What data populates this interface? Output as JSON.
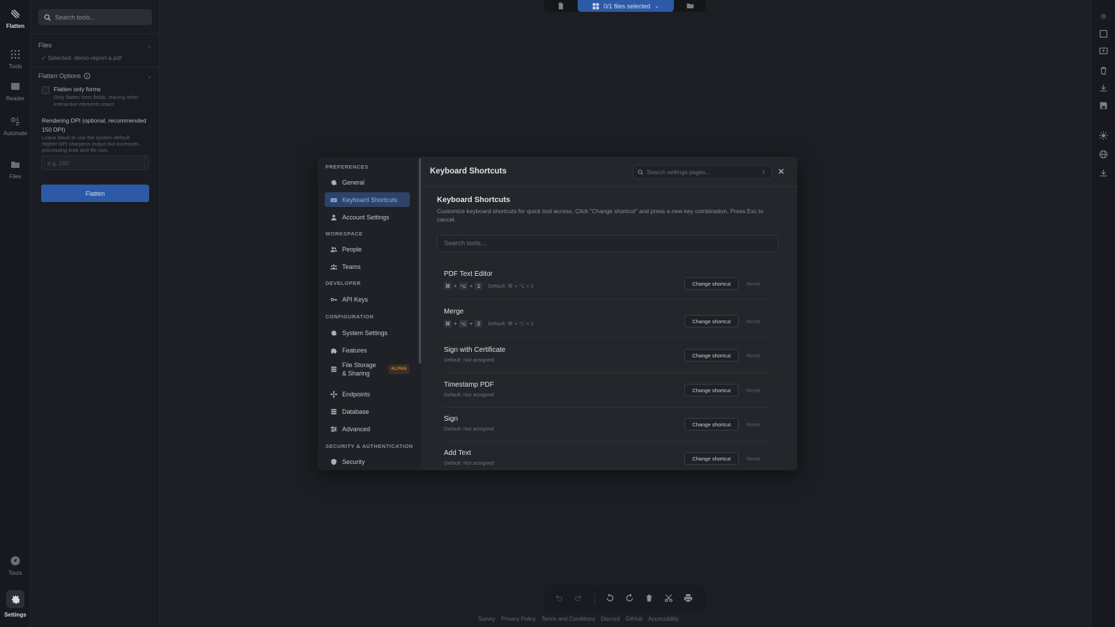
{
  "rail": {
    "items": [
      {
        "label": "Flatten",
        "icon": "flatten-icon"
      },
      {
        "label": "Tools",
        "icon": "grid-icon"
      },
      {
        "label": "Reader",
        "icon": "reader-icon"
      },
      {
        "label": "Automate",
        "icon": "automate-icon"
      },
      {
        "label": "Files",
        "icon": "folder-icon"
      },
      {
        "label": "Tours",
        "icon": "tours-icon"
      },
      {
        "label": "Settings",
        "icon": "gear-icon"
      }
    ]
  },
  "tool_panel": {
    "search_placeholder": "Search tools...",
    "files_header": "Files",
    "selected_file": "✓ Selected: demo-report-a.pdf",
    "options_header": "Flatten Options",
    "flatten_forms_label": "Flatten only forms",
    "flatten_forms_desc": "Only flatten form fields, leaving other interactive elements intact",
    "dpi_label": "Rendering DPI (optional, recommended 150 DPI)",
    "dpi_desc": "Leave blank to use the system default. Higher DPI sharpens output but increases processing time and file size.",
    "dpi_placeholder": "e.g. 150",
    "flatten_button": "Flatten"
  },
  "topbar": {
    "files_selected": "0/1 files selected"
  },
  "modal": {
    "title": "Keyboard Shortcuts",
    "search_placeholder": "Search settings pages...",
    "nav": {
      "groups": [
        "PREFERENCES",
        "WORKSPACE",
        "DEVELOPER",
        "CONFIGURATION",
        "SECURITY & AUTHENTICATION"
      ],
      "items": [
        {
          "label": "General",
          "icon": "gear-icon"
        },
        {
          "label": "Keyboard Shortcuts",
          "icon": "keyboard-icon"
        },
        {
          "label": "Account Settings",
          "icon": "user-icon"
        },
        {
          "label": "People",
          "icon": "people-icon"
        },
        {
          "label": "Teams",
          "icon": "teams-icon"
        },
        {
          "label": "API Keys",
          "icon": "key-icon"
        },
        {
          "label": "System Settings",
          "icon": "gear-icon"
        },
        {
          "label": "Features",
          "icon": "puzzle-icon"
        },
        {
          "label": "File Storage & Sharing",
          "icon": "storage-icon",
          "badge": "ALPHA"
        },
        {
          "label": "Endpoints",
          "icon": "endpoints-icon"
        },
        {
          "label": "Database",
          "icon": "database-icon"
        },
        {
          "label": "Advanced",
          "icon": "sliders-icon"
        },
        {
          "label": "Security",
          "icon": "shield-icon"
        }
      ]
    },
    "content": {
      "title": "Keyboard Shortcuts",
      "description": "Customize keyboard shortcuts for quick tool access. Click \"Change shortcut\" and press a new key combination. Press Esc to cancel.",
      "search_placeholder": "Search tools...",
      "change_label": "Change shortcut",
      "reset_label": "Reset",
      "shortcuts": [
        {
          "name": "PDF Text Editor",
          "keys": [
            "⌘",
            "⌥",
            "1"
          ],
          "default": "Default: ⌘ + ⌥ + 1"
        },
        {
          "name": "Merge",
          "keys": [
            "⌘",
            "⌥",
            "2"
          ],
          "default": "Default: ⌘ + ⌥ + 2"
        },
        {
          "name": "Sign with Certificate",
          "keys": [],
          "default": "Default: Not assigned"
        },
        {
          "name": "Timestamp PDF",
          "keys": [],
          "default": "Default: Not assigned"
        },
        {
          "name": "Sign",
          "keys": [],
          "default": "Default: Not assigned"
        },
        {
          "name": "Add Text",
          "keys": [],
          "default": "Default: Not assigned"
        }
      ]
    }
  },
  "footer": {
    "links": [
      "Survey",
      "Privacy Policy",
      "Terms and Conditions",
      "Discord",
      "GitHub",
      "Accessibility"
    ]
  },
  "colors": {
    "accent": "#2d5aa6",
    "active_nav": "#2d4468",
    "alpha_badge": "#d38a3c"
  }
}
